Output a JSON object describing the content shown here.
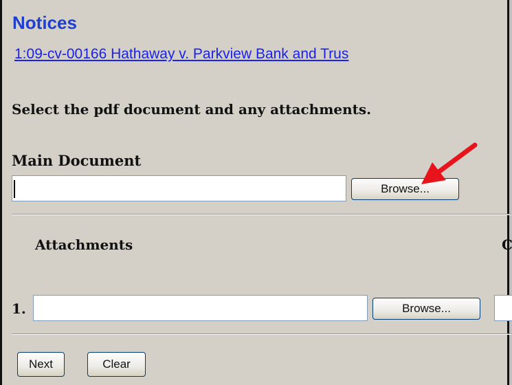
{
  "header": {
    "title": "Notices",
    "case_link": "1:09-cv-00166 Hathaway v. Parkview Bank and Trus"
  },
  "form": {
    "instruction": "Select the pdf document and any attachments.",
    "main_document": {
      "label": "Main Document",
      "value": "",
      "browse_label": "Browse..."
    },
    "attachments": {
      "heading": "Attachments",
      "cut_heading": "C",
      "rows": [
        {
          "number": "1.",
          "value": "",
          "browse_label": "Browse..."
        }
      ]
    },
    "buttons": {
      "next_label": "Next",
      "clear_label": "Clear"
    }
  },
  "annotation": {
    "arrow_color": "#e8141c",
    "arrow_icon": "red-arrow-pointer"
  },
  "colors": {
    "title": "#1e3fcf",
    "link": "#1a22e8",
    "background": "#d4d0c8"
  }
}
